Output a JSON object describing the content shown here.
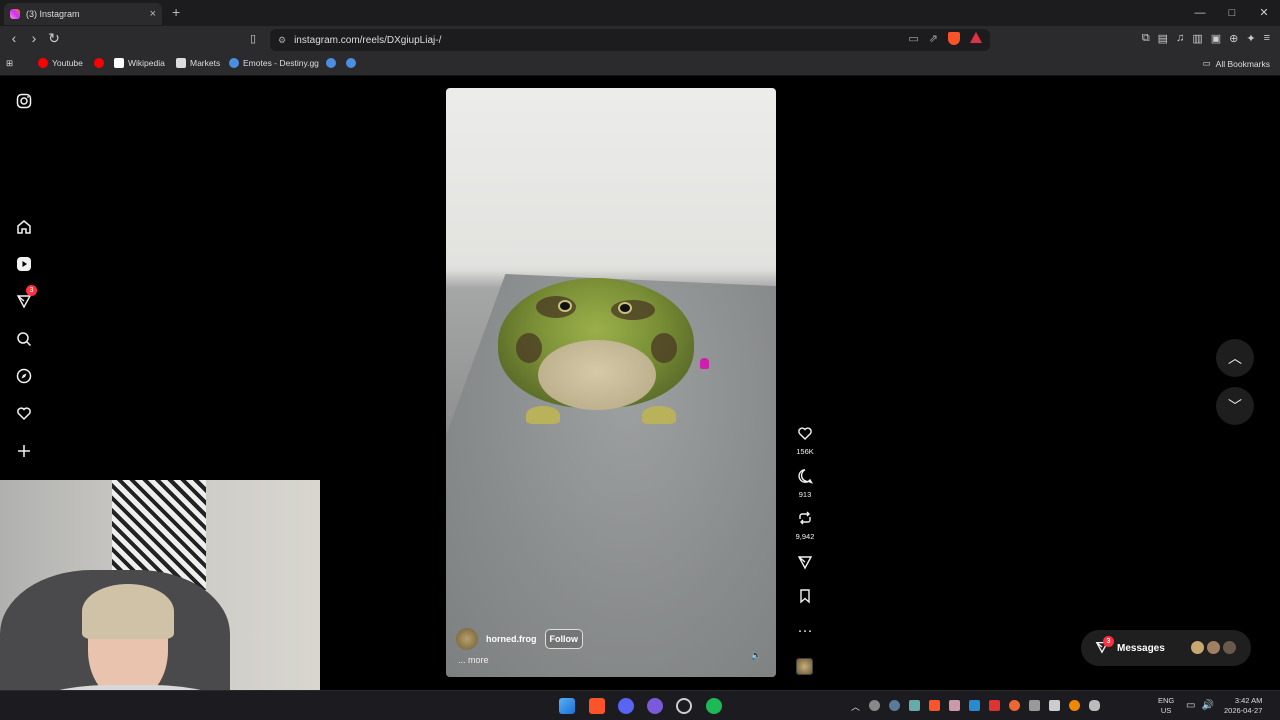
{
  "browser": {
    "tab_title": "(3) Instagram",
    "tab_close": "×",
    "new_tab": "+",
    "url": "instagram.com/reels/DXgiupLiaj-/",
    "window_controls": [
      "—",
      "□",
      "✕"
    ],
    "bookmarks": [
      {
        "label": "Youtube",
        "color": "#ff0000"
      },
      {
        "label": "",
        "color": "#ff0000"
      },
      {
        "label": "Wikipedia",
        "color": "#ffffff"
      },
      {
        "label": "Markets",
        "color": "#e0e0e0"
      },
      {
        "label": "Emotes - Destiny.gg",
        "color": "#4a8fe0"
      },
      {
        "label": "",
        "color": "#4a8fe0"
      }
    ],
    "all_bookmarks": "All Bookmarks"
  },
  "sidebar": {
    "items": [
      {
        "name": "instagram-logo-icon",
        "glyph": "◎"
      },
      {
        "name": "home-icon",
        "glyph": "⌂"
      },
      {
        "name": "reels-icon",
        "glyph": "▶"
      },
      {
        "name": "send-icon",
        "glyph": "▽",
        "badge": "3"
      },
      {
        "name": "search-icon",
        "glyph": "⌕"
      },
      {
        "name": "explore-icon",
        "glyph": "⊘"
      },
      {
        "name": "heart-icon",
        "glyph": "♡"
      },
      {
        "name": "create-icon",
        "glyph": "+"
      }
    ]
  },
  "reel": {
    "username": "horned.frog",
    "follow_label": "Follow",
    "caption_more": "... more",
    "likes": "156K",
    "comments": "913",
    "reposts": "9,942",
    "mute_glyph": "🔈"
  },
  "navigation": {
    "up": "︿",
    "down": "﹀"
  },
  "messages": {
    "label": "Messages",
    "badge": "3"
  },
  "taskbar": {
    "lang_line1": "ENG",
    "lang_line2": "US",
    "time": "3:42 AM",
    "date": "2026-04-27"
  }
}
